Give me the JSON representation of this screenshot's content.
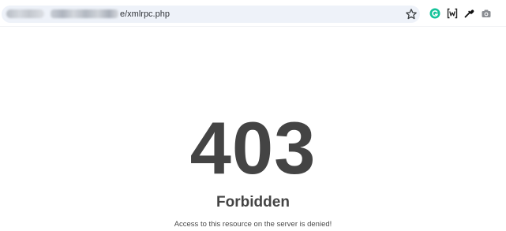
{
  "browser": {
    "address_bar": {
      "url_visible_suffix": "e/xmlrpc.php"
    },
    "icons": {
      "bookmark": "star-icon",
      "extensions": [
        "grammarly-icon",
        "bracket-w-icon",
        "eyedropper-icon",
        "camera-icon"
      ]
    },
    "colors": {
      "omnibox_bg": "#eef2f9",
      "grammarly": "#15c39a"
    }
  },
  "page": {
    "error_code": "403",
    "error_title": "Forbidden",
    "error_message": "Access to this resource on the server is denied!"
  }
}
